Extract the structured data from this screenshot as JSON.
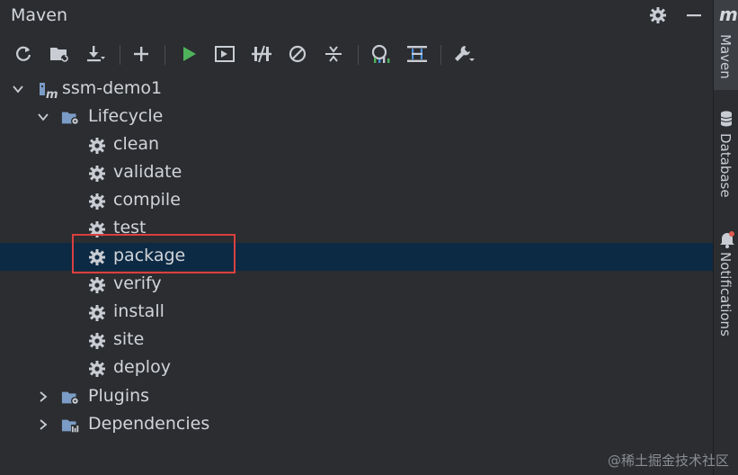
{
  "window": {
    "title": "Maven"
  },
  "titlebar": {
    "settings_icon": "gear-icon",
    "hide_icon": "minus-icon"
  },
  "toolbar": {
    "items": [
      {
        "name": "reload-icon"
      },
      {
        "name": "add-maven-project-icon"
      },
      {
        "name": "download-sources-icon"
      },
      {
        "name": "add-icon"
      },
      {
        "name": "run-icon"
      },
      {
        "name": "execute-goal-icon"
      },
      {
        "name": "toggle-offline-icon"
      },
      {
        "name": "skip-tests-icon"
      },
      {
        "name": "collapse-all-icon"
      },
      {
        "name": "analyze-dependencies-icon"
      },
      {
        "name": "show-diagram-icon"
      },
      {
        "name": "maven-settings-icon"
      }
    ]
  },
  "tree": {
    "project": "ssm-demo1",
    "lifecycle": "Lifecycle",
    "goals": [
      "clean",
      "validate",
      "compile",
      "test",
      "package",
      "verify",
      "install",
      "site",
      "deploy"
    ],
    "plugins": "Plugins",
    "dependencies": "Dependencies",
    "selected": "package"
  },
  "sidebar": {
    "logo": "m",
    "tabs": [
      "Maven",
      "Database",
      "Notifications"
    ]
  },
  "watermark": "@稀土掘金技术社区",
  "colors": {
    "accent_run": "#4fb35b",
    "selection": "#0d2a44",
    "highlight_box": "#d94040",
    "folder": "#7a9cc6"
  }
}
